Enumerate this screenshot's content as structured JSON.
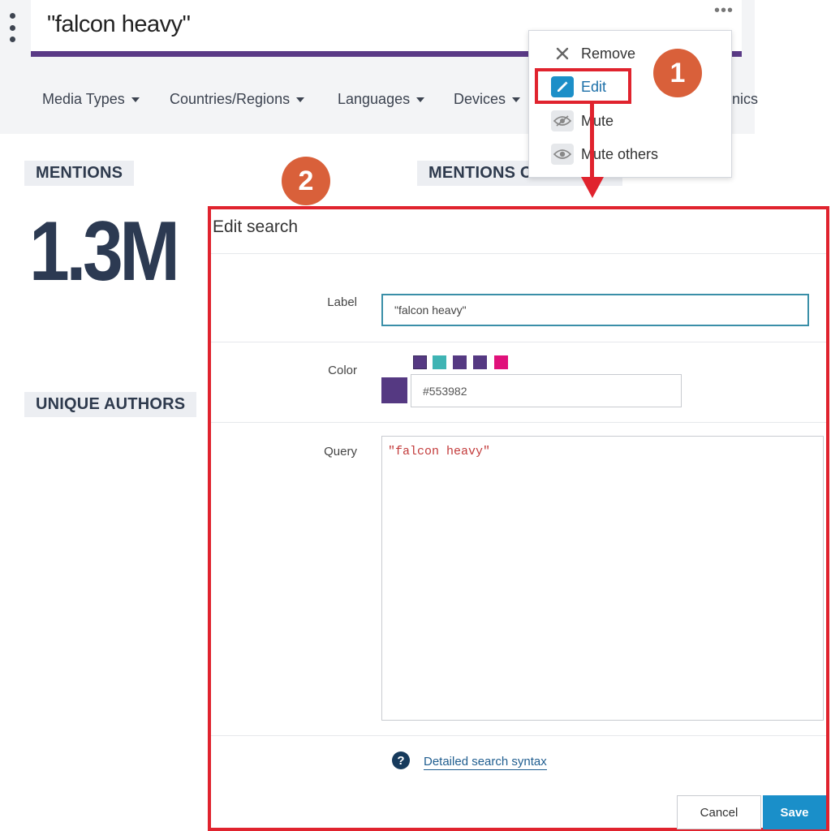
{
  "search": {
    "title": "\"falcon heavy\"",
    "more_label": "•••"
  },
  "filters": [
    {
      "label": "Media Types"
    },
    {
      "label": "Countries/Regions"
    },
    {
      "label": "Languages"
    },
    {
      "label": "Devices"
    }
  ],
  "filters_cut_label": "nics",
  "cards": {
    "mentions_label": "MENTIONS",
    "mentions_value": "1.3M",
    "mentions_over_time_label": "MENTIONS OVER TIME",
    "unique_authors_label": "UNIQUE AUTHORS"
  },
  "menu": {
    "items": [
      {
        "label": "Remove",
        "icon": "close-icon"
      },
      {
        "label": "Edit",
        "icon": "pencil-icon"
      },
      {
        "label": "Mute",
        "icon": "eye-off-icon"
      },
      {
        "label": "Mute others",
        "icon": "eye-icon"
      }
    ]
  },
  "annotations": {
    "step1": "1",
    "step2": "2",
    "highlight_color": "#e0232e",
    "badge_color": "#d9603a"
  },
  "dialog": {
    "title": "Edit search",
    "label_field_label": "Label",
    "label_value": "\"falcon heavy\"",
    "color_field_label": "Color",
    "swatches": [
      "#553982",
      "#3fb4b4",
      "#553982",
      "#553982",
      "#e0117a"
    ],
    "selected_color": "#553982",
    "color_value": "#553982",
    "query_field_label": "Query",
    "query_value": "\"falcon heavy\"",
    "help_link": "Detailed search syntax",
    "cancel_label": "Cancel",
    "save_label": "Save"
  },
  "colors": {
    "accent_purple": "#5a3a86",
    "primary_blue": "#1a8fc9"
  }
}
